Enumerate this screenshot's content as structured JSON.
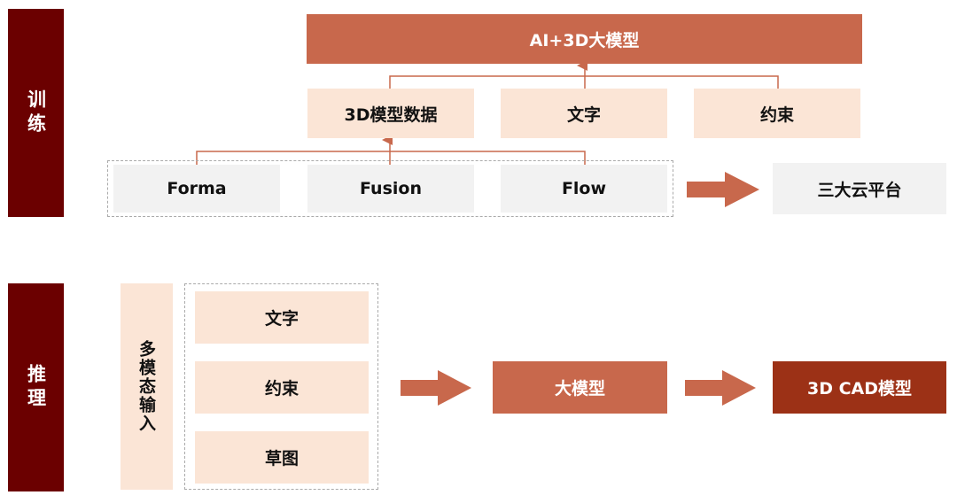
{
  "training": {
    "label": "训练",
    "model": "AI+3D大模型",
    "inputs": [
      "3D模型数据",
      "文字",
      "约束"
    ],
    "sources": [
      "Forma",
      "Fusion",
      "Flow"
    ],
    "platform": "三大云平台"
  },
  "inference": {
    "label": "推理",
    "multimodal_label": "多模态输入",
    "inputs": [
      "文字",
      "约束",
      "草图"
    ],
    "model": "大模型",
    "output": "3D CAD模型"
  },
  "colors": {
    "side": "#6b0000",
    "accent": "#c8684c",
    "light": "#fbe5d6",
    "gray": "#f2f2f2",
    "output": "#9c3116"
  }
}
